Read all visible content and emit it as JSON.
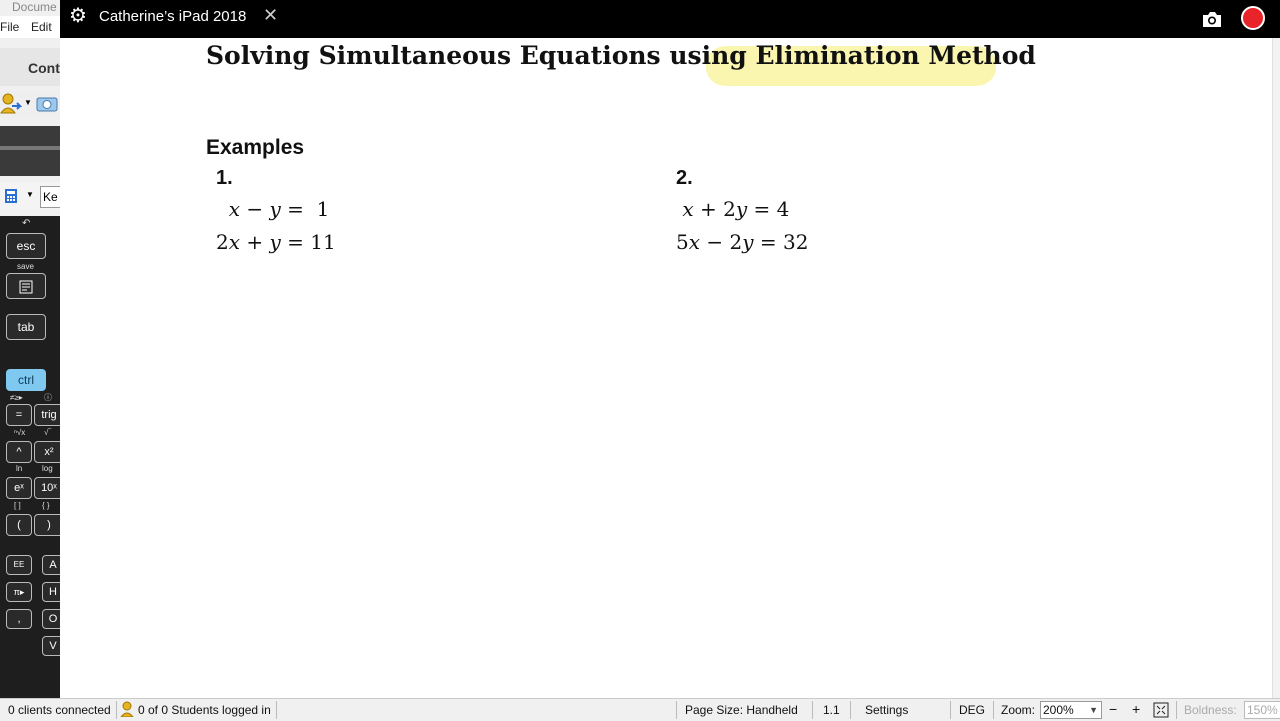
{
  "left_app": {
    "doc_tab": "Docume",
    "menu": {
      "file": "File",
      "edit": "Edit"
    },
    "cont_label": "Cont",
    "keypad_field": "Ke",
    "calculator": {
      "undo_label": "↶",
      "esc": "esc",
      "save_label": "save",
      "tab": "tab",
      "ctrl": "ctrl",
      "eq": "=",
      "trig": "trig",
      "caret": "^",
      "x2": "x²",
      "ln_label": "ln",
      "log_label": "log",
      "ex": "eˣ",
      "tenx": "10ˣ",
      "lparen": "(",
      "rparen": ")",
      "ee": "EE",
      "pi": "π▸",
      "comma": ",",
      "a": "A",
      "h": "H",
      "o": "O",
      "v": "V"
    }
  },
  "topbar": {
    "title": "Catherine’s iPad 2018",
    "close": "✕",
    "gear": "⚙"
  },
  "document": {
    "title_plain": "Solving Simultaneous Equations using ",
    "title_highlight": "Elimination Method",
    "examples_heading": "Examples",
    "examples": [
      {
        "number": "1.",
        "eq1": "  x − y =  1",
        "eq2": "2x + y = 11"
      },
      {
        "number": "2.",
        "eq1": " x + 2y = 4",
        "eq2": "5x − 2y = 32"
      }
    ]
  },
  "statusbar": {
    "clients": "0 clients connected",
    "students": "0 of 0 Students logged in",
    "page_size": "Page Size: Handheld",
    "page_num": "1.1",
    "settings": "Settings",
    "angle": "DEG",
    "zoom_label": "Zoom:",
    "zoom_value": "200%",
    "zoom_out": "−",
    "zoom_in": "+",
    "boldness_label": "Boldness:",
    "boldness_value": "150%"
  },
  "colors": {
    "highlight": "#faf6b0",
    "record": "#e8232a",
    "ctrl_key": "#7fc8f0"
  }
}
